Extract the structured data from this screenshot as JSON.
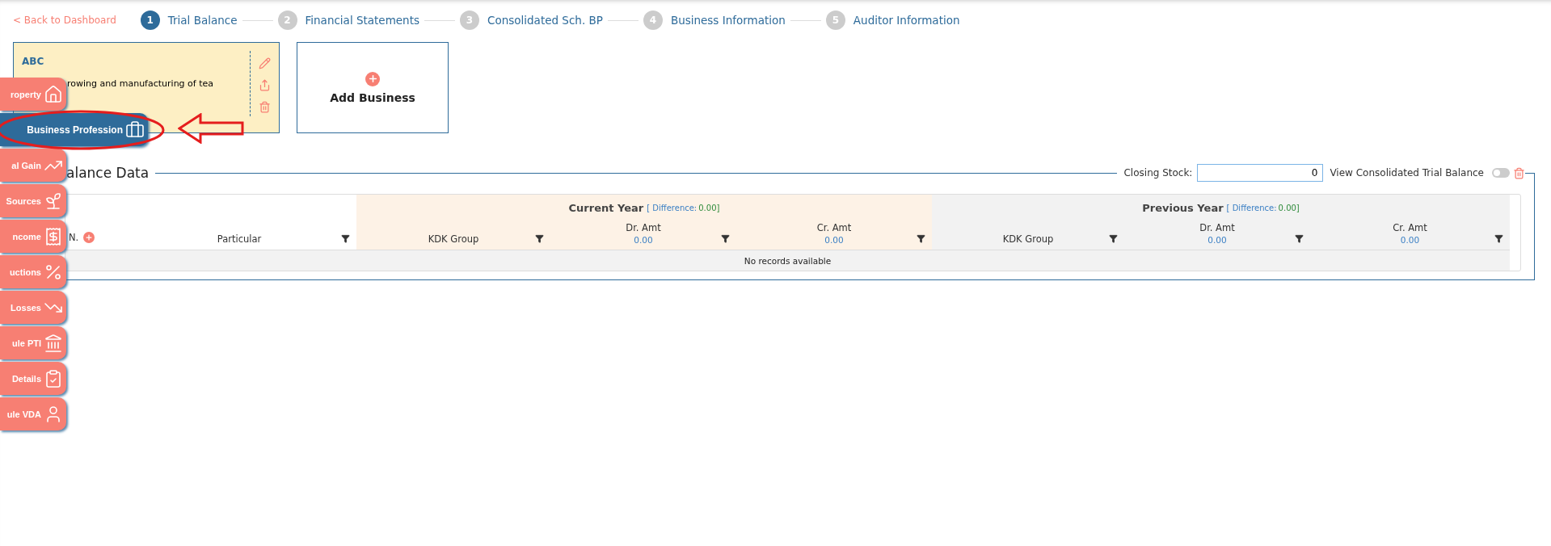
{
  "back_link": "< Back to Dashboard",
  "steps": [
    {
      "number": "1",
      "label": "Trial Balance",
      "selected": true
    },
    {
      "number": "2",
      "label": "Financial Statements",
      "selected": false
    },
    {
      "number": "3",
      "label": "Consolidated Sch. BP",
      "selected": false
    },
    {
      "number": "4",
      "label": "Business Information",
      "selected": false
    },
    {
      "number": "5",
      "label": "Auditor Information",
      "selected": false
    }
  ],
  "business_cards": [
    {
      "name": "ABC",
      "description": "rowing and manufacturing of tea"
    }
  ],
  "add_business": {
    "label": "Add Business"
  },
  "sidebar": {
    "items": [
      {
        "label": "roperty",
        "selected": false
      },
      {
        "label": "Business Profession",
        "selected": true
      },
      {
        "label": "al Gain",
        "selected": false
      },
      {
        "label": "Sources",
        "selected": false
      },
      {
        "label": "ncome",
        "selected": false
      },
      {
        "label": "uctions",
        "selected": false
      },
      {
        "label": "Losses",
        "selected": false
      },
      {
        "label": "ule PTI",
        "selected": false
      },
      {
        "label": "Details",
        "selected": false
      },
      {
        "label": "ule VDA",
        "selected": false
      }
    ]
  },
  "trial_balance": {
    "title": "alance Data",
    "closing_stock": {
      "label": "Closing Stock:",
      "value": "0"
    },
    "consolidated_toggle": {
      "label": "View Consolidated Trial Balance",
      "on": false
    },
    "table": {
      "leading_columns": [
        {
          "label": "N.",
          "kind": "serial"
        },
        {
          "label": "Particular",
          "kind": "text"
        }
      ],
      "groups": [
        {
          "title": "Current Year",
          "difference_label": "[ Difference:",
          "difference_value": "0.00]",
          "columns": [
            {
              "label": "KDK Group",
              "kind": "text"
            },
            {
              "label": "Dr. Amt",
              "total": "0.00",
              "kind": "amount"
            },
            {
              "label": "Cr. Amt",
              "total": "0.00",
              "kind": "amount"
            }
          ]
        },
        {
          "title": "Previous Year",
          "difference_label": "[ Difference:",
          "difference_value": "0.00]",
          "columns": [
            {
              "label": "KDK Group",
              "kind": "text"
            },
            {
              "label": "Dr. Amt",
              "total": "0.00",
              "kind": "amount"
            },
            {
              "label": "Cr. Amt",
              "total": "0.00",
              "kind": "amount"
            }
          ]
        }
      ],
      "empty_message": "No records available"
    }
  }
}
